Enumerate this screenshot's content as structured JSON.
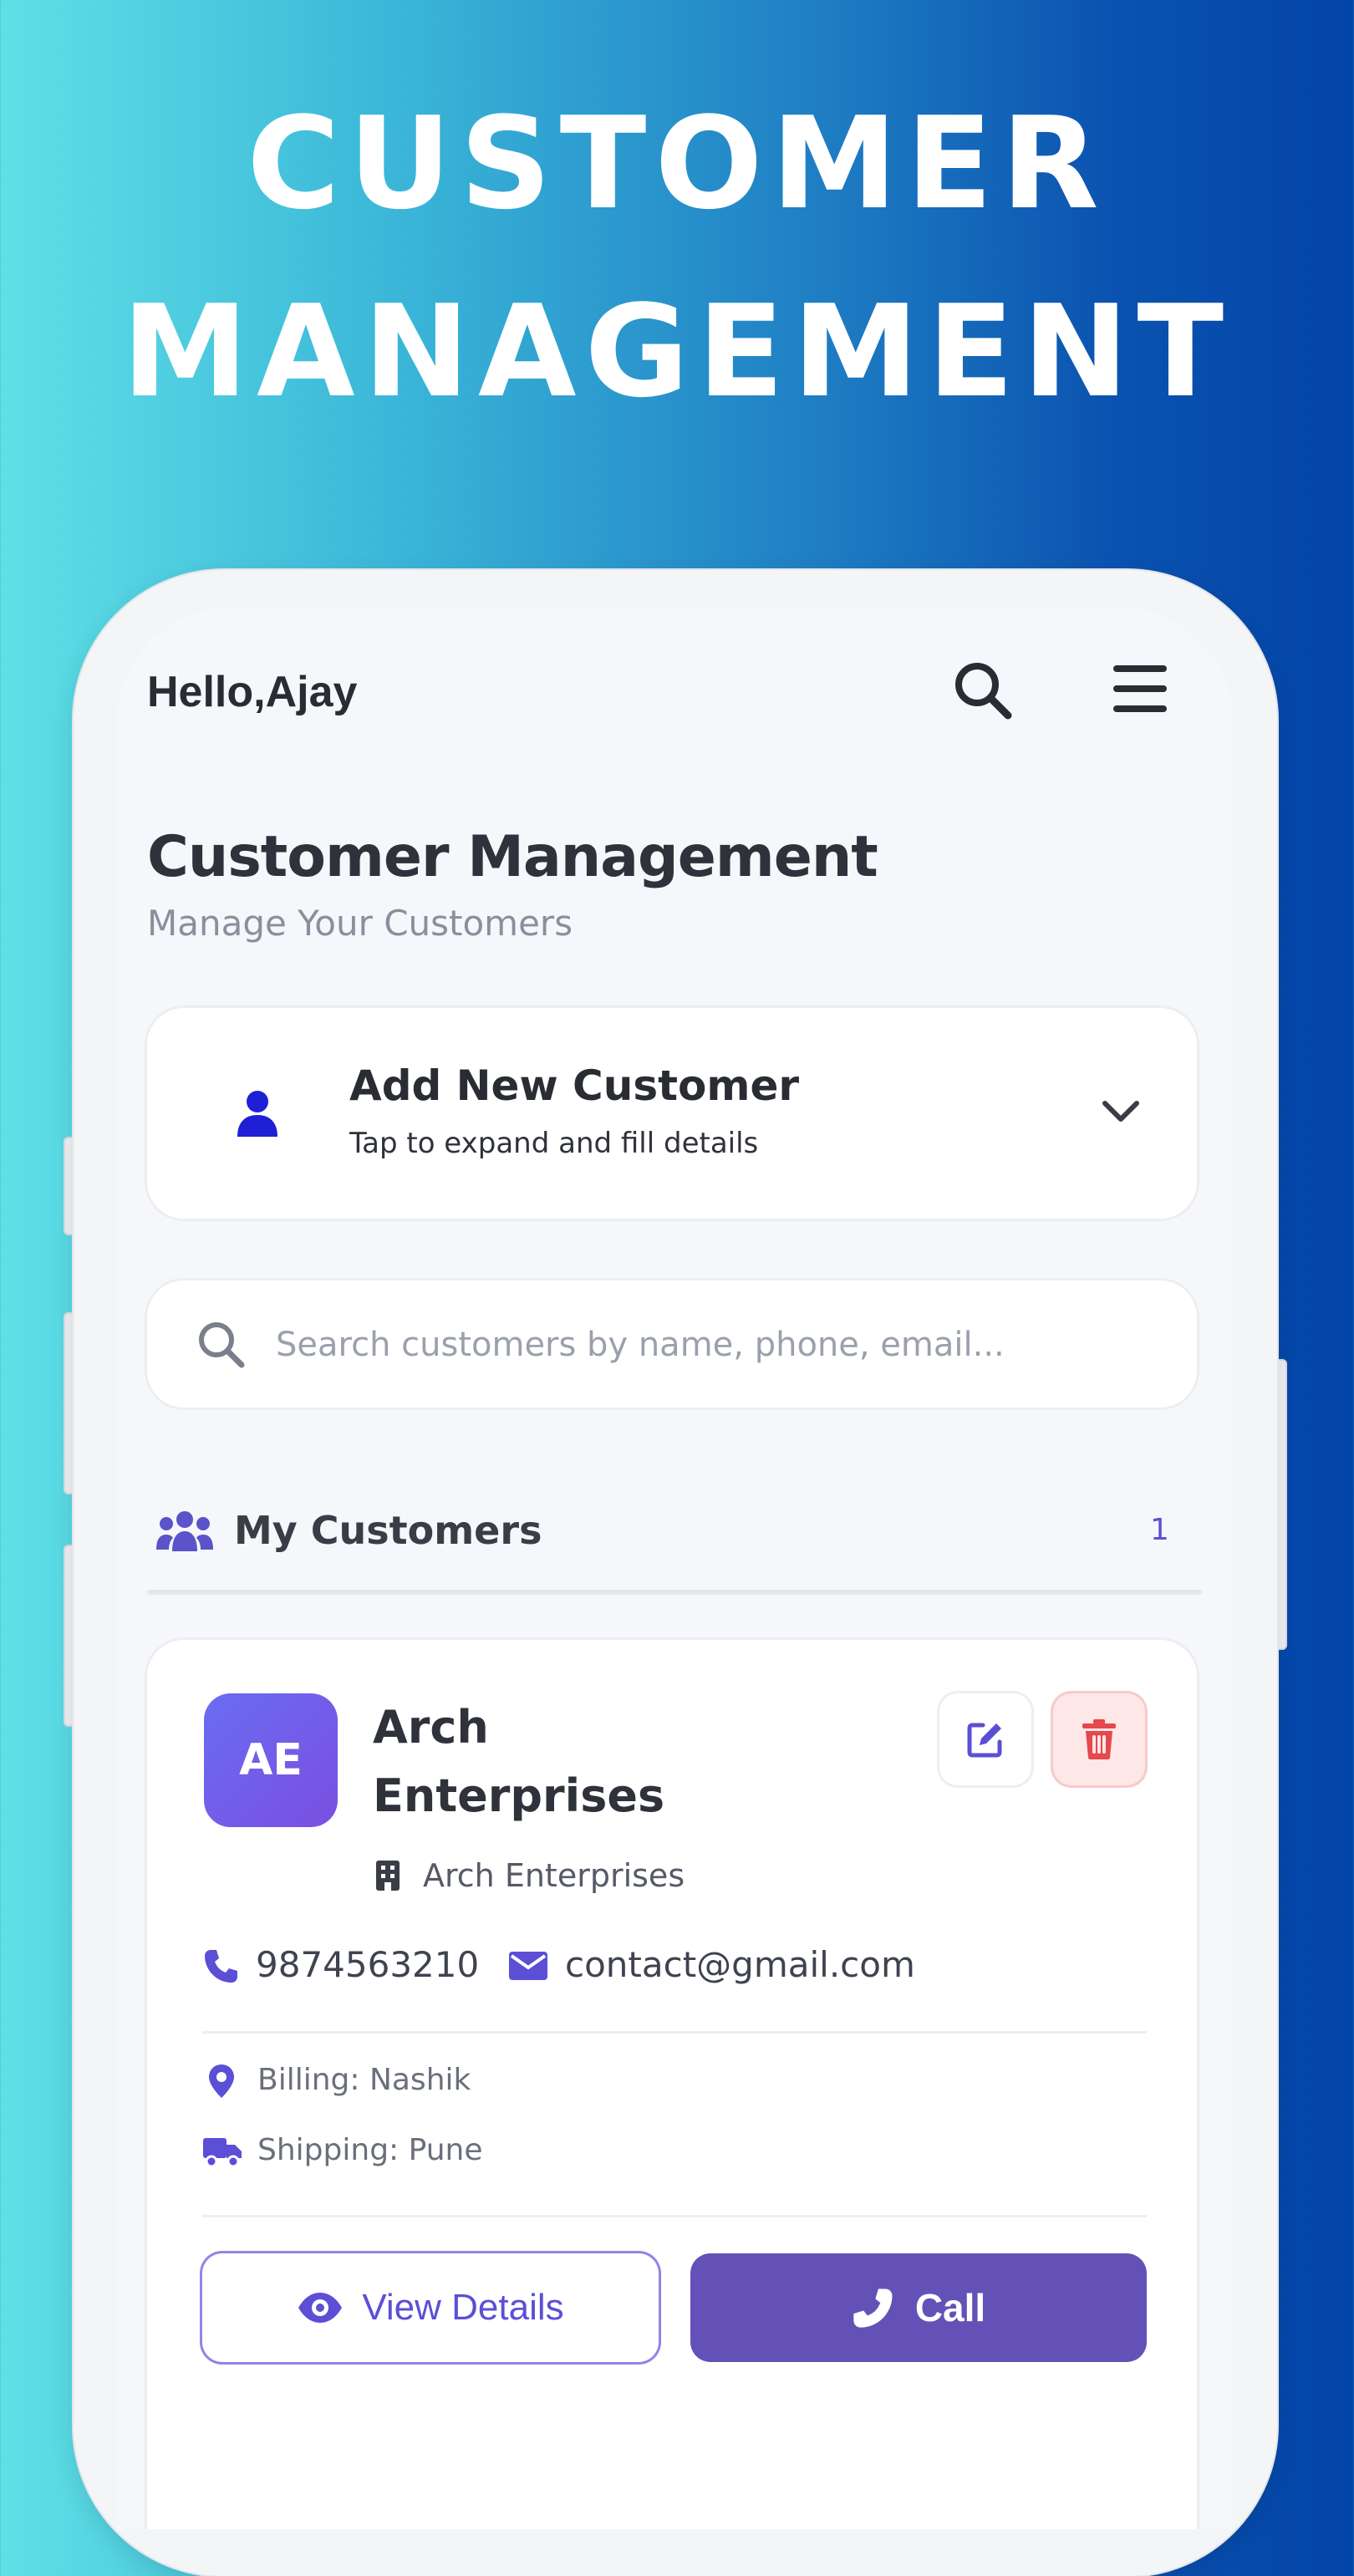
{
  "promo": {
    "line1": "CUSTOMER",
    "line2": "MANAGEMENT"
  },
  "header": {
    "greeting": "Hello,Ajay",
    "icons": [
      "search-icon",
      "menu-icon"
    ]
  },
  "page": {
    "title": "Customer Management",
    "subtitle": "Manage Your Customers"
  },
  "add_customer": {
    "title": "Add New Customer",
    "subtitle": "Tap to expand and fill details",
    "icon": "user-icon",
    "toggle_icon": "chevron-down-icon"
  },
  "search": {
    "placeholder": "Search customers by name, phone, email...",
    "value": ""
  },
  "section": {
    "title": "My Customers",
    "count": "1",
    "icon": "users-icon"
  },
  "customers": [
    {
      "initials": "AE",
      "name": "Arch Enterprises",
      "company": "Arch Enterprises",
      "phone": "9874563210",
      "email": "contact@gmail.com",
      "billing": "Billing: Nashik",
      "shipping": "Shipping: Pune",
      "actions": {
        "view_label": "View Details",
        "call_label": "Call"
      }
    }
  ],
  "colors": {
    "accent": "#5b4fd6",
    "call_button": "#6451b8",
    "avatar": "#7058e8",
    "danger": "#e5484d"
  }
}
